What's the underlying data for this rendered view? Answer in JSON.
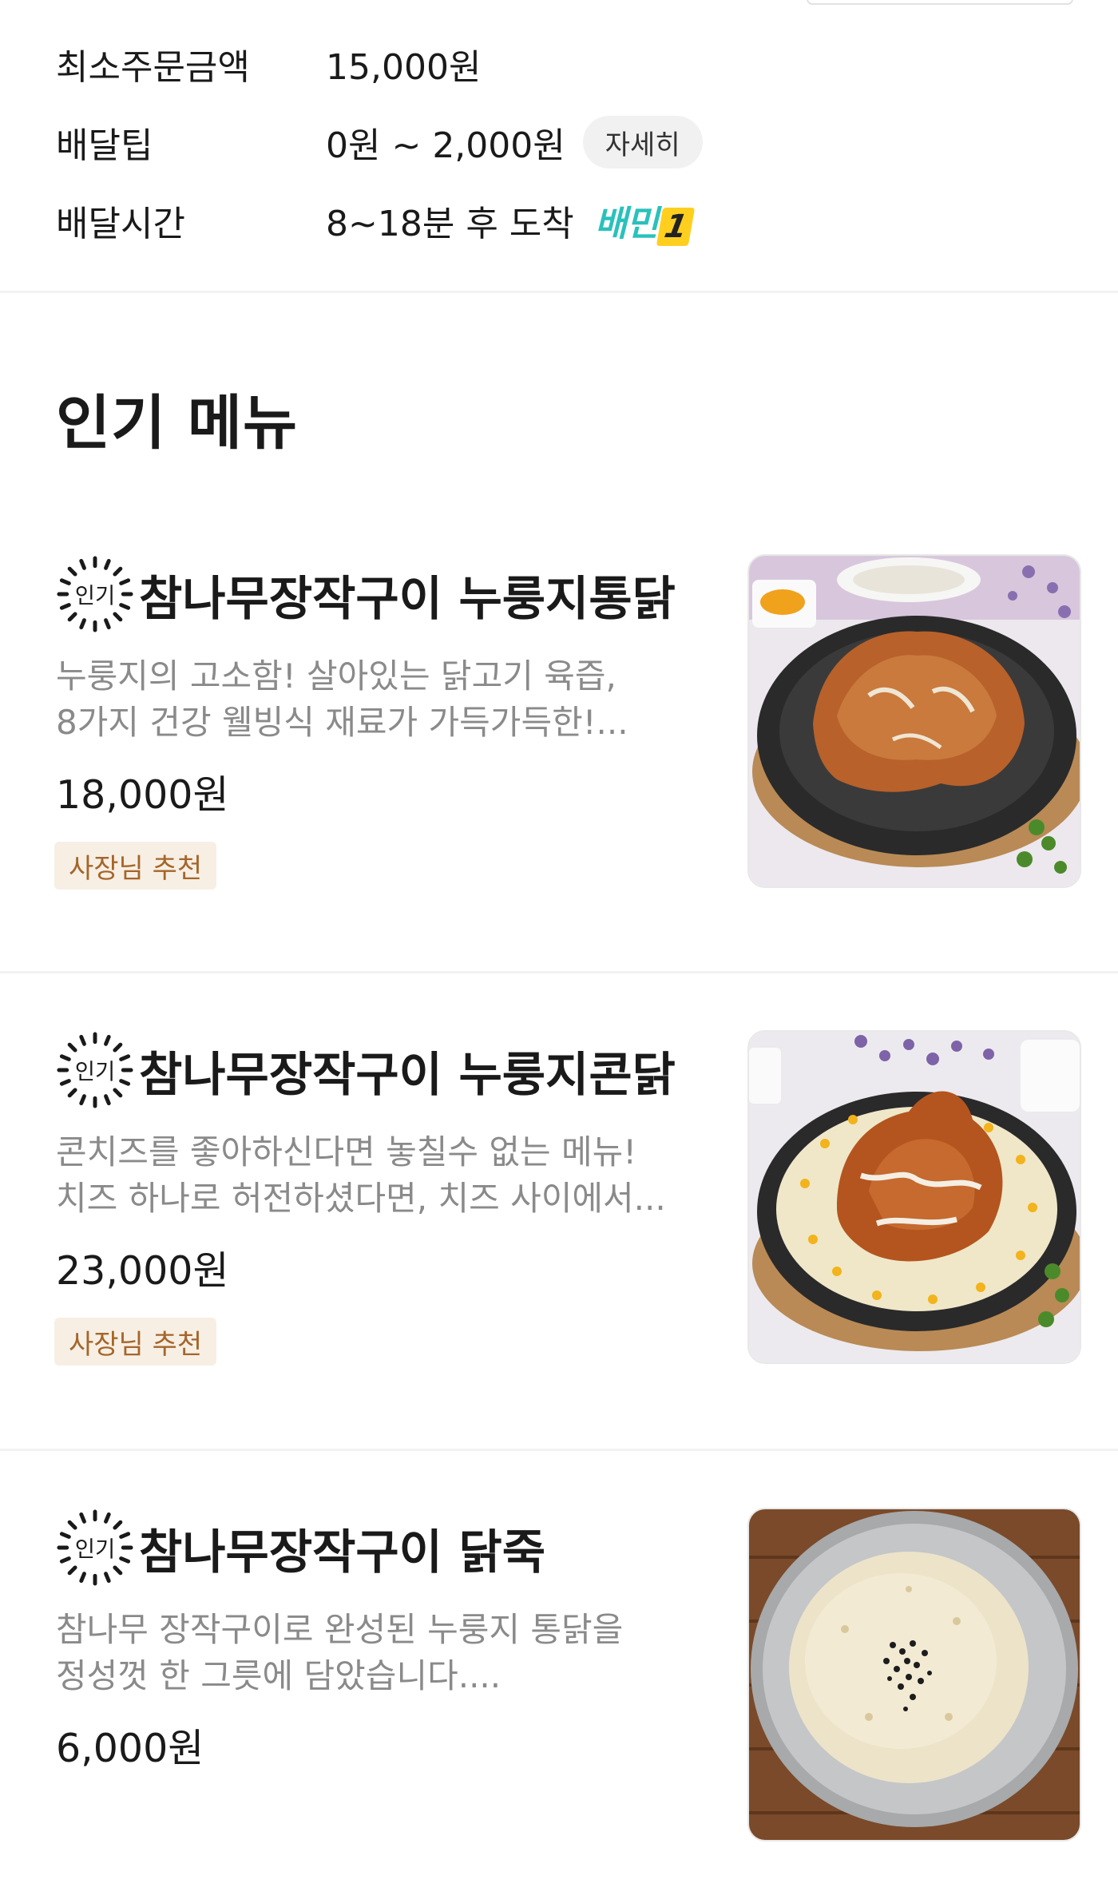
{
  "delivery_info": {
    "min_order": {
      "label": "최소주문금액",
      "value": "15,000원"
    },
    "delivery_tip": {
      "label": "배달팁",
      "value": "0원 ~ 2,000원",
      "detail_button": "자세히"
    },
    "delivery_time": {
      "label": "배달시간",
      "value": "8~18분 후 도착",
      "badge_text": "배민",
      "badge_number": "1"
    }
  },
  "popular_section": {
    "title": "인기 메뉴",
    "badge_label": "인기",
    "items": [
      {
        "name": "참나무장작구이 누룽지통닭",
        "desc_line1": "누룽지의 고소함! 살아있는 닭고기 육즙,",
        "desc_line2": "8가지 건강 웰빙식 재료가 가득가득한!...",
        "price": "18,000원",
        "tag": "사장님 추천",
        "image_icon": "roast-chicken-photo"
      },
      {
        "name": "참나무장작구이 누룽지콘닭",
        "desc_line1": "콘치즈를 좋아하신다면 놓칠수 없는 메뉴!",
        "desc_line2": "치즈 하나로 허전하셨다면, 치즈 사이에서...",
        "price": "23,000원",
        "tag": "사장님 추천",
        "image_icon": "corn-cheese-chicken-photo"
      },
      {
        "name": "참나무장작구이 닭죽",
        "desc_line1": "참나무 장작구이로 완성된 누룽지 통닭을",
        "desc_line2": "정성껏 한 그릇에 담았습니다....",
        "price": "6,000원",
        "image_icon": "chicken-porridge-photo"
      }
    ]
  },
  "colors": {
    "brand_mint": "#2ac1bc",
    "tag_bg": "#f7efe4",
    "tag_text": "#a5652a",
    "desc_text": "#8a8a8a"
  }
}
